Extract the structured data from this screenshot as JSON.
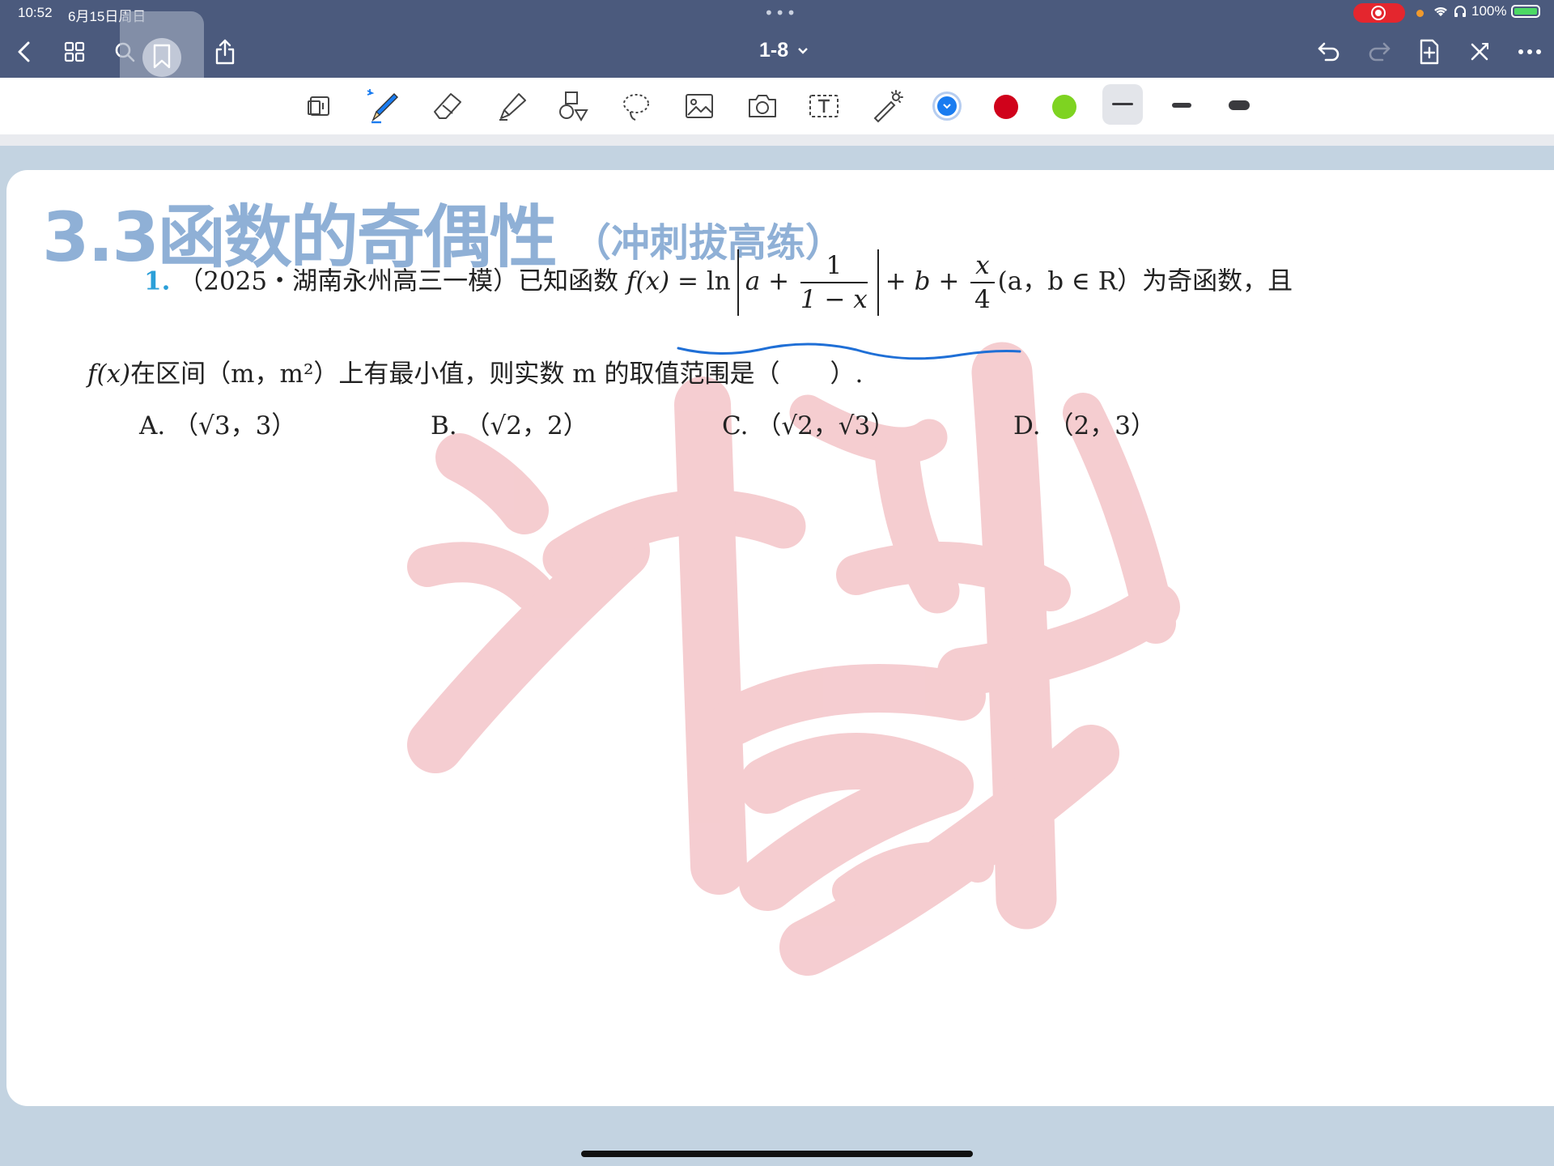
{
  "status_bar": {
    "time": "10:52",
    "date": "6月15日周日",
    "battery": "100%"
  },
  "nav": {
    "title": "1-8",
    "title_icon": "chevron-down-icon",
    "left_icons": [
      "back-icon",
      "grid-icon",
      "search-icon",
      "bookmark-icon",
      "share-icon"
    ],
    "right_icons": [
      "undo-icon",
      "redo-icon",
      "add-page-icon",
      "close-icon",
      "more-icon"
    ]
  },
  "toolbar": {
    "tools": [
      "reading-mode-icon",
      "pen-icon",
      "eraser-icon",
      "highlighter-icon",
      "shapes-icon",
      "lasso-icon",
      "image-icon",
      "camera-icon",
      "text-box-icon",
      "laser-pointer-icon"
    ],
    "colors": [
      "#1a7cf0",
      "#d0021b",
      "#7ed321"
    ],
    "strokes": [
      "thin",
      "medium",
      "thick"
    ]
  },
  "page": {
    "heading": "3.3函数的奇偶性",
    "subheading": "（冲刺拔高练）",
    "question": {
      "number": "1.",
      "source": "（2025・湖南永州高三一模）已知函数",
      "func": "f(x)",
      "eq_ln": "= ln",
      "abs_a": "a +",
      "frac1_num": "1",
      "frac1_den": "1 − x",
      "plus_b": "+ b +",
      "frac2_num": "x",
      "frac2_den": "4",
      "condition": "(a，b ∈ R）为奇函数，且",
      "line2_func": "f(x)",
      "line2_text": "在区间（m，m²）上有最小值，则实数 m 的取值范围是（　　）."
    },
    "choices": [
      {
        "letter": "A.",
        "text": "（√3，3）"
      },
      {
        "letter": "B.",
        "text": "（√2，2）"
      },
      {
        "letter": "C.",
        "text": "（√2，√3）"
      },
      {
        "letter": "D.",
        "text": "（2，3）"
      }
    ],
    "annotation_color": "#1f6fd6",
    "watermark_color": "#f4c8cc"
  }
}
